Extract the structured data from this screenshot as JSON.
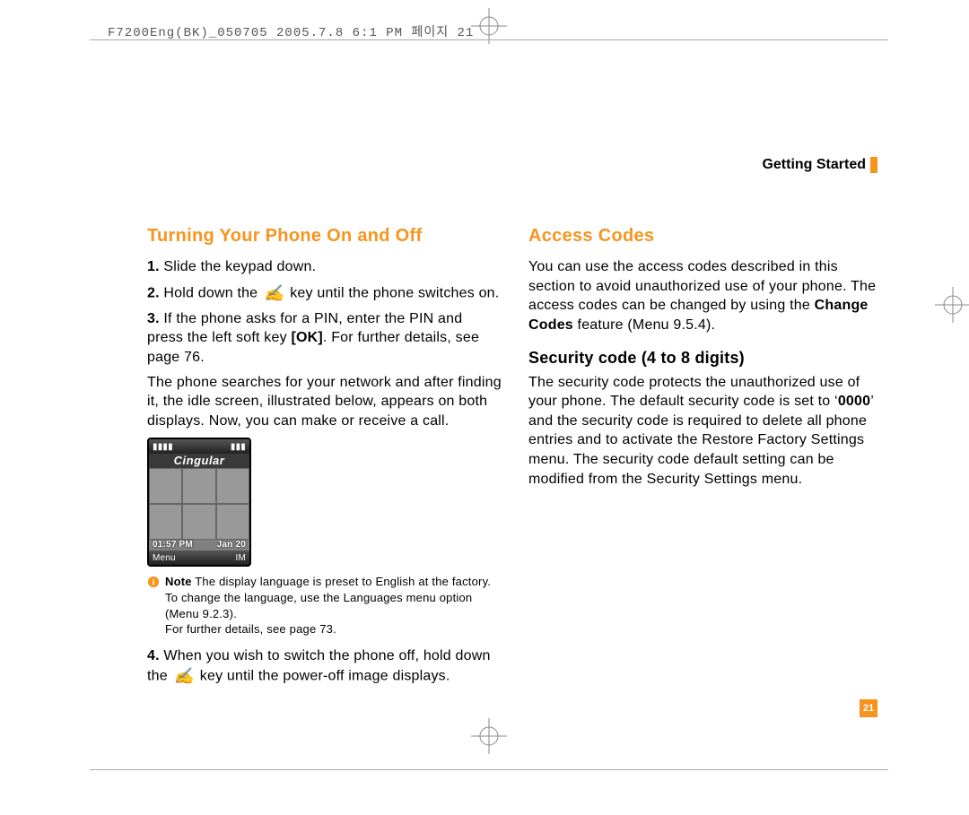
{
  "slug": "F7200Eng(BK)_050705  2005.7.8  6:1 PM  페이지 21",
  "section_label": "Getting Started",
  "page_number": "21",
  "left": {
    "title": "Turning Your Phone On and Off",
    "step1_n": "1.",
    "step1": " Slide the keypad down.",
    "step2_n": "2.",
    "step2_a": " Hold down the ",
    "step2_b": " key until the phone switches on.",
    "step3_n": "3.",
    "step3_a": " If the phone asks for a PIN, enter the PIN and press the left soft key ",
    "step3_ok": "[OK]",
    "step3_b": ". For further details, see page 76.",
    "para_search": "The phone searches for your network and after finding it, the idle screen, illustrated below, appears on both displays. Now, you can make or receive a call.",
    "phone": {
      "signal": "▮▮▮▮",
      "battery": "▮▮▮",
      "carrier": "Cingular",
      "time": "01:57 PM",
      "date": "Jan 20",
      "soft_left": "Menu",
      "soft_right": "IM"
    },
    "note_label": "Note",
    "note_text": "The display language is preset to English at the factory. To change the language, use the Languages menu option (Menu 9.2.3).\nFor further details, see page 73.",
    "step4_n": "4.",
    "step4_a": " When you wish to switch the phone off, hold down the ",
    "step4_b": " key until the power-off image displays."
  },
  "right": {
    "title": "Access Codes",
    "intro_a": "You can use the access codes described in this section to avoid unauthorized use of your phone. The access codes can be changed by using the ",
    "intro_bold": "Change Codes",
    "intro_b": " feature (Menu 9.5.4).",
    "sub1": "Security code (4 to 8 digits)",
    "sub1_a": "The security code protects the unauthorized use of your phone. The default security code is set to ‘",
    "sub1_code": "0000",
    "sub1_b": "’ and the security code is required to delete all phone entries and to activate the Restore Factory Settings menu. The security code default setting can be modified from the Security Settings menu."
  }
}
